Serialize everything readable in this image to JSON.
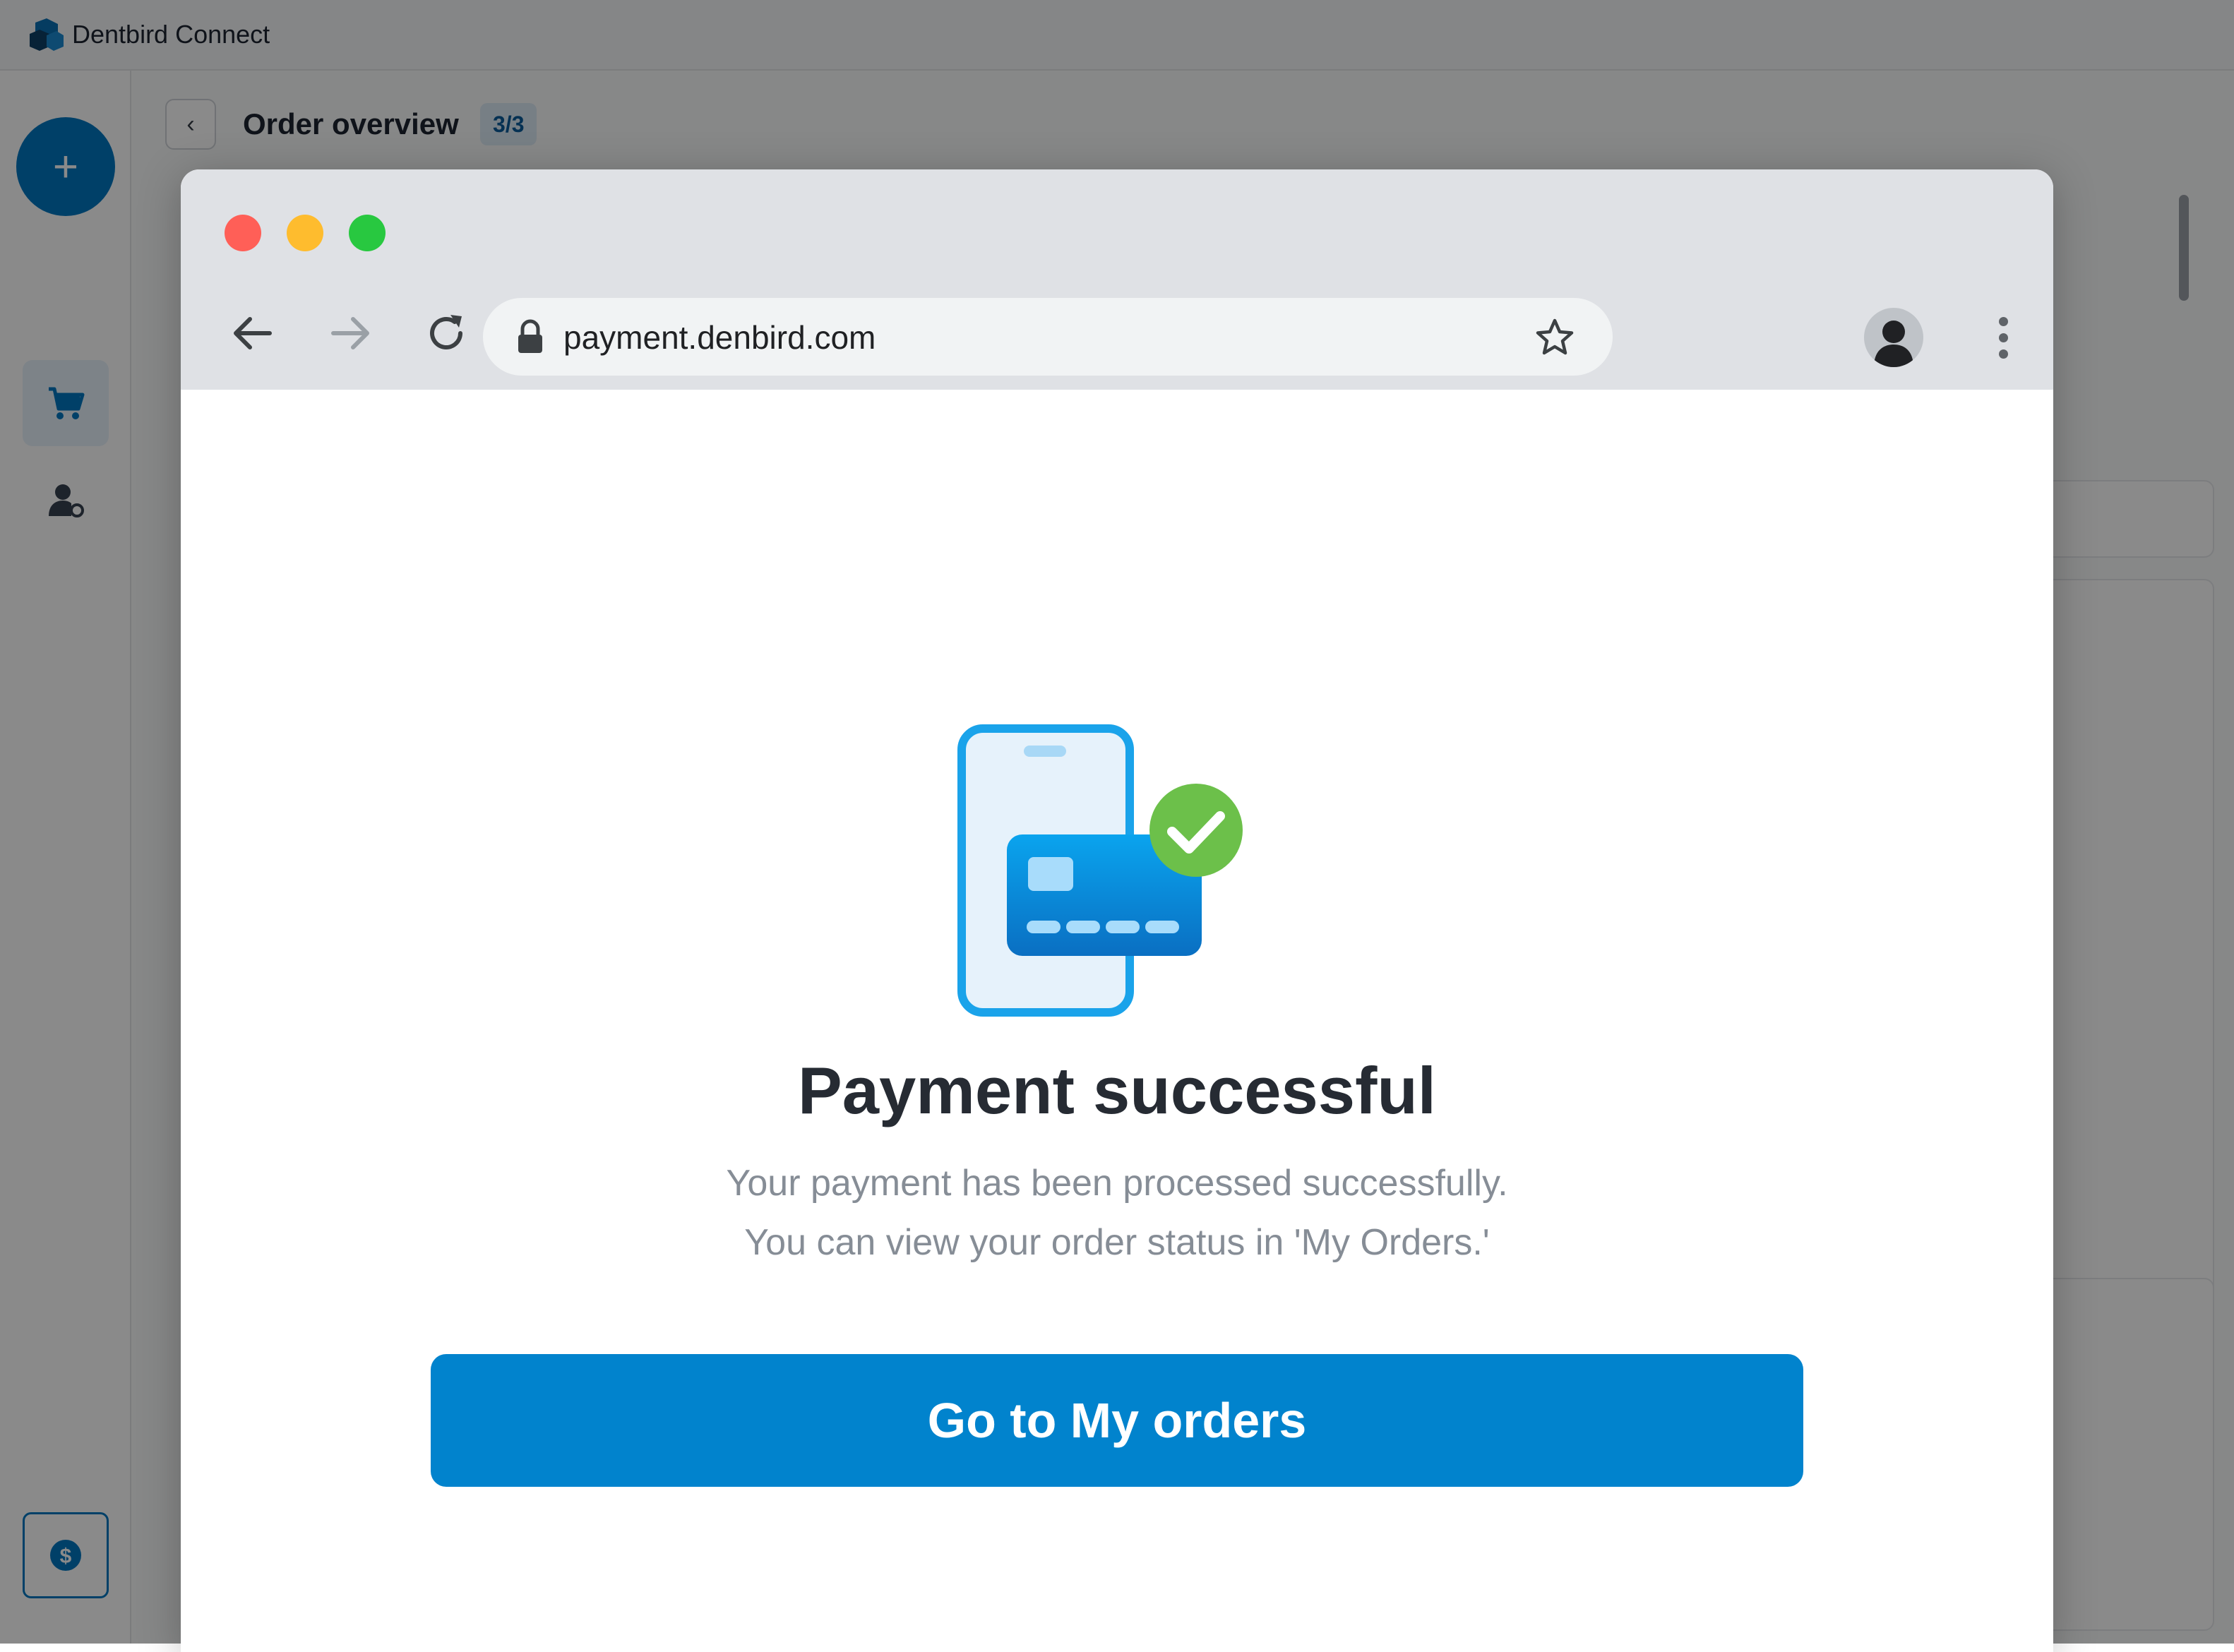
{
  "app": {
    "title": "Dentbird Connect",
    "order_title": "Order overview",
    "order_step": "3/3",
    "create_button": "+"
  },
  "sidebar": {
    "items": [
      {
        "icon": "chart-icon",
        "active": false
      },
      {
        "icon": "cart-icon",
        "active": true
      },
      {
        "icon": "user-settings-icon",
        "active": false
      }
    ],
    "billing_icon": "dollar-coin-icon"
  },
  "browser": {
    "url": "payment.denbird.com"
  },
  "payment": {
    "title": "Payment successful",
    "description_line1": "Your payment has been processed successfully.",
    "description_line2": "You can view your order status in 'My Orders.'",
    "button_label": "Go to My orders"
  },
  "colors": {
    "brand": "#0177c1",
    "cta": "#0183cd",
    "success": "#6cc04a",
    "traffic_red": "#ff5f57",
    "traffic_yellow": "#febc2e",
    "traffic_green": "#28c840"
  }
}
